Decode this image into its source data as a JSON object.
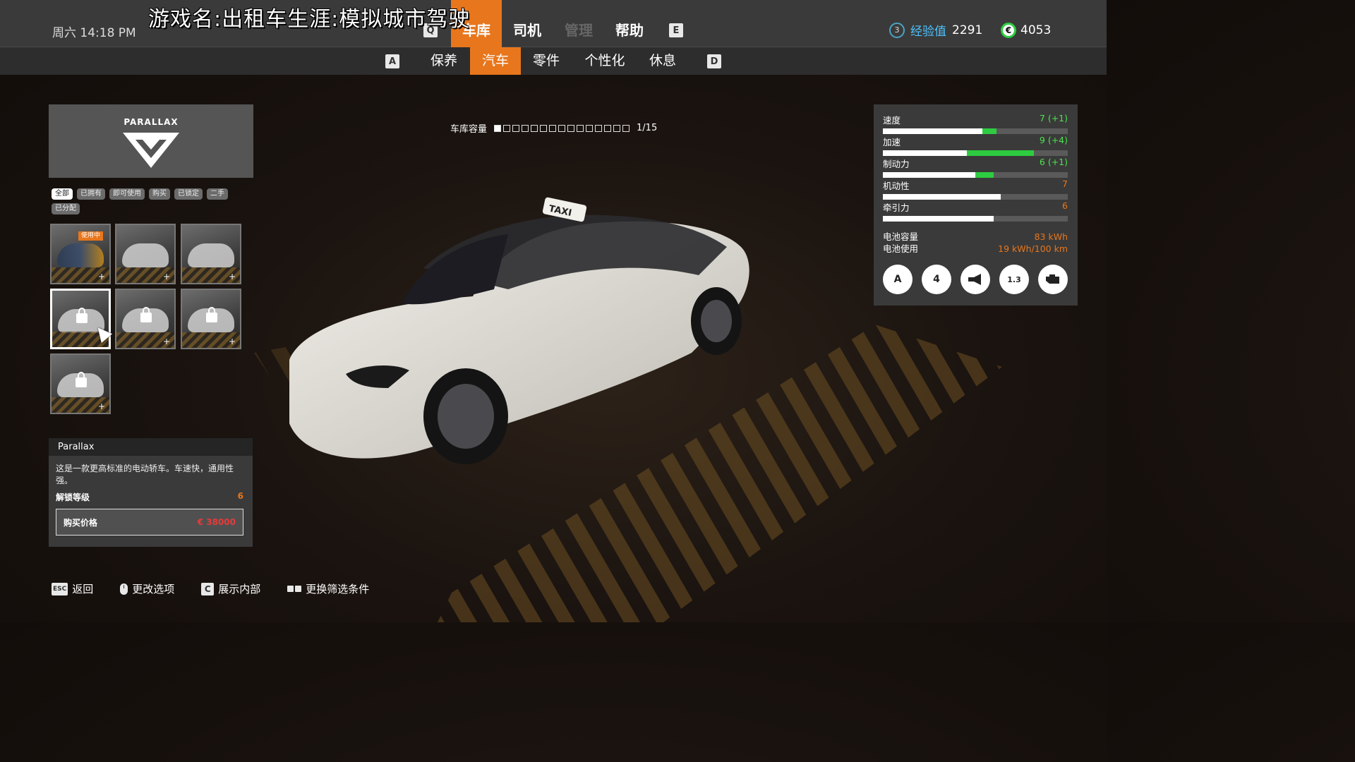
{
  "watermark": "游戏名:出租车生涯:模拟城市驾驶",
  "header": {
    "clock": "周六  14:18 PM",
    "prev_key": "Q",
    "next_key": "E",
    "tabs": [
      {
        "label": "车库",
        "active": true
      },
      {
        "label": "司机",
        "active": false
      },
      {
        "label": "管理",
        "active": false,
        "disabled": true
      },
      {
        "label": "帮助",
        "active": false
      }
    ],
    "xp": {
      "level": "3",
      "label": "经验值",
      "value": "2291"
    },
    "money": {
      "icon": "euro-icon",
      "symbol": "€",
      "value": "4053"
    }
  },
  "subnav": {
    "prev_key": "A",
    "next_key": "D",
    "tabs": [
      {
        "label": "保养",
        "active": false
      },
      {
        "label": "汽车",
        "active": true
      },
      {
        "label": "零件",
        "active": false
      },
      {
        "label": "个性化",
        "active": false
      },
      {
        "label": "休息",
        "active": false
      }
    ]
  },
  "brand": {
    "name": "PARALLAX",
    "logo": "parallax-logo"
  },
  "filters": [
    "全部",
    "已拥有",
    "即可使用",
    "购买",
    "已锁定",
    "二手",
    "已分配"
  ],
  "cars": [
    {
      "state": "in-use",
      "badge": "使用中"
    },
    {
      "state": "owned"
    },
    {
      "state": "owned"
    },
    {
      "state": "locked",
      "selected": true
    },
    {
      "state": "locked"
    },
    {
      "state": "locked"
    },
    {
      "state": "locked"
    }
  ],
  "garage": {
    "label": "车库容量",
    "used": 1,
    "total": 15,
    "text": "1/15"
  },
  "info": {
    "title": "Parallax",
    "description": "这是一款更高标准的电动轿车。车速快，通用性强。",
    "unlock_label": "解锁等级",
    "unlock_value": "6",
    "price_label": "购买价格",
    "price_value": "€ 38000"
  },
  "stats": [
    {
      "label": "速度",
      "display": "7 (+1)",
      "base": 7,
      "bonus": 1,
      "max": 13
    },
    {
      "label": "加速",
      "display": "9 (+4)",
      "base": 5,
      "bonus": 4,
      "max": 11
    },
    {
      "label": "制动力",
      "display": "6 (+1)",
      "base": 5,
      "bonus": 1,
      "max": 10
    },
    {
      "label": "机动性",
      "display": "7",
      "base": 7,
      "bonus": 0,
      "max": 11
    },
    {
      "label": "牵引力",
      "display": "6",
      "base": 6,
      "bonus": 0,
      "max": 10
    }
  ],
  "battery": {
    "capacity_label": "电池容量",
    "capacity_value": "83 kWh",
    "usage_label": "电池使用",
    "usage_value": "19 kWh/100 km"
  },
  "features": [
    {
      "icon": "accessibility-icon",
      "text": "A"
    },
    {
      "icon": "seats-icon",
      "text": "4"
    },
    {
      "icon": "horn-icon",
      "text": ""
    },
    {
      "icon": "weight-icon",
      "text": "1.3"
    },
    {
      "icon": "engine-icon",
      "text": ""
    }
  ],
  "footer": [
    {
      "key": "ESC",
      "label": "返回"
    },
    {
      "key": "mouse",
      "label": "更改选项"
    },
    {
      "key": "C",
      "label": "展示内部"
    },
    {
      "key": "filter",
      "label": "更换筛选条件"
    }
  ],
  "colors": {
    "accent": "#e8761c",
    "bonus": "#2ecc40",
    "price": "#e53b3b",
    "xp": "#4ec3ff"
  }
}
